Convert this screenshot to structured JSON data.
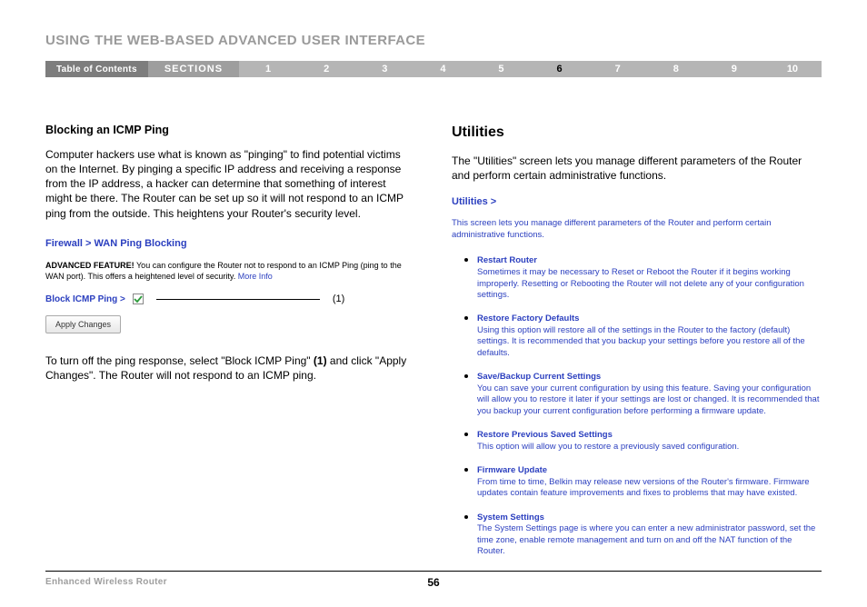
{
  "page_header": "USING THE WEB-BASED ADVANCED USER INTERFACE",
  "nav": {
    "toc": "Table of Contents",
    "sections": "SECTIONS",
    "items": [
      "1",
      "2",
      "3",
      "4",
      "5",
      "6",
      "7",
      "8",
      "9",
      "10"
    ],
    "active_index": 5
  },
  "left": {
    "heading": "Blocking an ICMP Ping",
    "body": "Computer hackers use what is known as \"pinging\" to find potential victims on the Internet. By pinging a specific IP address and receiving a response from the IP address, a hacker can determine that something of interest might be there. The Router can be set up so it will not respond to an ICMP ping from the outside. This heightens your Router's security level.",
    "firewall_breadcrumb": "Firewall >  WAN Ping Blocking",
    "adv_feature_bold": "ADVANCED FEATURE!",
    "adv_feature_text": " You can configure the Router not to respond to an ICMP Ping (ping to the WAN port). This offers a heightened level of security. ",
    "more_info": "More Info",
    "block_icmp_label": "Block ICMP Ping >",
    "annotation": "(1)",
    "apply_btn": "Apply Changes",
    "instr_prefix": "To turn off the ping response, select \"Block ICMP Ping\" ",
    "instr_bold": "(1)",
    "instr_suffix": " and click \"Apply Changes\". The Router will not respond to an ICMP ping."
  },
  "right": {
    "heading": "Utilities",
    "intro": "The \"Utilities\" screen lets you manage different parameters of the Router and perform certain administrative functions.",
    "link": "Utilities >",
    "intro2": "This screen lets you manage different parameters of the Router and perform certain administrative functions.",
    "items": [
      {
        "title": "Restart Router",
        "desc": "Sometimes it may be necessary to Reset or Reboot the Router if it begins working improperly. Resetting or Rebooting the Router will not delete any of your configuration settings."
      },
      {
        "title": "Restore Factory Defaults",
        "desc": "Using this option will restore all of the settings in the Router to the factory (default) settings. It is recommended that you backup your settings before you restore all of the defaults."
      },
      {
        "title": "Save/Backup Current Settings",
        "desc": "You can save your current configuration by using this feature. Saving your configuration will allow you to restore it later if your settings are lost or changed. It is recommended that you backup your current configuration before performing a firmware update."
      },
      {
        "title": "Restore Previous Saved Settings",
        "desc": "This option will allow you to restore a previously saved configuration."
      },
      {
        "title": "Firmware Update",
        "desc": "From time to time, Belkin may release new versions of the Router's firmware. Firmware updates contain feature improvements and fixes to problems that may have existed."
      },
      {
        "title": "System Settings",
        "desc": "The System Settings page is where you can enter a new administrator password, set the time zone, enable remote management and turn on and off the NAT function of the Router."
      }
    ]
  },
  "footer": {
    "product": "Enhanced Wireless Router",
    "page": "56"
  }
}
